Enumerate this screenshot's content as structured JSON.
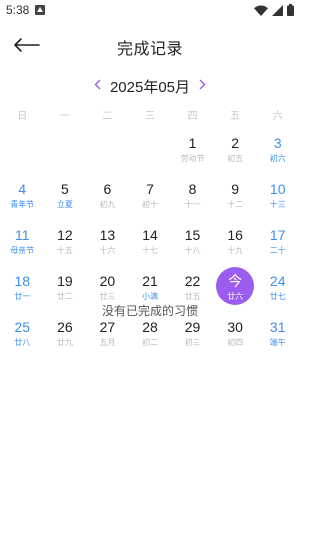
{
  "status_bar": {
    "time": "5:38",
    "app_icon": "notification-app-icon",
    "wifi_icon": "wifi-icon",
    "signal_icon": "cell-signal-icon",
    "battery_icon": "battery-icon"
  },
  "header": {
    "back_icon": "arrow-left-icon",
    "title": "完成记录"
  },
  "month_nav": {
    "prev_icon": "chevron-left-icon",
    "label": "2025年05月",
    "next_icon": "chevron-right-icon"
  },
  "weekdays": [
    "日",
    "一",
    "二",
    "三",
    "四",
    "五",
    "六"
  ],
  "colors": {
    "accent_blue": "#3d8ef2",
    "today_purple": "#9b5cf0",
    "weekday_gray": "#c8c8c8"
  },
  "days": [
    {
      "num": "",
      "sub": ""
    },
    {
      "num": "",
      "sub": ""
    },
    {
      "num": "",
      "sub": ""
    },
    {
      "num": "",
      "sub": ""
    },
    {
      "num": "1",
      "sub": "劳动节"
    },
    {
      "num": "2",
      "sub": "初五"
    },
    {
      "num": "3",
      "sub": "初六"
    },
    {
      "num": "4",
      "sub": "青年节"
    },
    {
      "num": "5",
      "sub": "立夏"
    },
    {
      "num": "6",
      "sub": "初九"
    },
    {
      "num": "7",
      "sub": "初十"
    },
    {
      "num": "8",
      "sub": "十一"
    },
    {
      "num": "9",
      "sub": "十二"
    },
    {
      "num": "10",
      "sub": "十三"
    },
    {
      "num": "11",
      "sub": "母亲节"
    },
    {
      "num": "12",
      "sub": "十五"
    },
    {
      "num": "13",
      "sub": "十六"
    },
    {
      "num": "14",
      "sub": "十七"
    },
    {
      "num": "15",
      "sub": "十八"
    },
    {
      "num": "16",
      "sub": "十九"
    },
    {
      "num": "17",
      "sub": "二十"
    },
    {
      "num": "18",
      "sub": "廿一"
    },
    {
      "num": "19",
      "sub": "廿二"
    },
    {
      "num": "20",
      "sub": "廿三"
    },
    {
      "num": "21",
      "sub": "小满"
    },
    {
      "num": "22",
      "sub": "廿五"
    },
    {
      "num": "今",
      "sub": "廿六"
    },
    {
      "num": "24",
      "sub": "廿七"
    },
    {
      "num": "25",
      "sub": "廿八"
    },
    {
      "num": "26",
      "sub": "廿九"
    },
    {
      "num": "27",
      "sub": "五月"
    },
    {
      "num": "28",
      "sub": "初二"
    },
    {
      "num": "29",
      "sub": "初三"
    },
    {
      "num": "30",
      "sub": "初四"
    },
    {
      "num": "31",
      "sub": "端午"
    }
  ],
  "empty_message": "没有已完成的习惯"
}
